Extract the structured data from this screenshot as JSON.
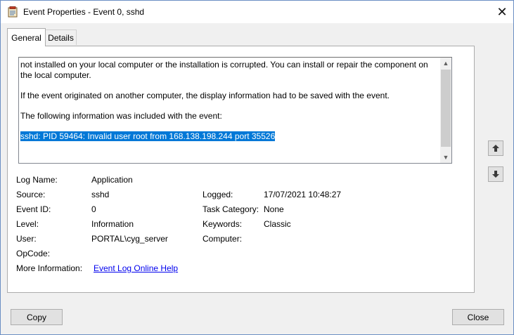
{
  "window": {
    "title": "Event Properties - Event 0, sshd",
    "close_glyph": "✕"
  },
  "tabs": [
    {
      "label": "General",
      "selected": true
    },
    {
      "label": "Details",
      "selected": false
    }
  ],
  "message": {
    "paragraphs": [
      "not installed on your local computer or the installation is corrupted. You can install or repair the component on the local computer.",
      "If the event originated on another computer, the display information had to be saved with the event.",
      "The following information was included with the event:"
    ],
    "selected_line": "sshd: PID 59464: Invalid user root from 168.138.198.244 port 35526",
    "scroll_up_glyph": "▲",
    "scroll_down_glyph": "▼"
  },
  "fields": {
    "log_name_label": "Log Name:",
    "log_name_value": "Application",
    "source_label": "Source:",
    "source_value": "sshd",
    "logged_label": "Logged:",
    "logged_value": "17/07/2021 10:48:27",
    "event_id_label": "Event ID:",
    "event_id_value": "0",
    "task_category_label": "Task Category:",
    "task_category_value": "None",
    "level_label": "Level:",
    "level_value": "Information",
    "keywords_label": "Keywords:",
    "keywords_value": "Classic",
    "user_label": "User:",
    "user_value": "PORTAL\\cyg_server",
    "computer_label": "Computer:",
    "computer_value": "",
    "opcode_label": "OpCode:",
    "opcode_value": "",
    "more_info_label": "More Information:",
    "more_info_link": "Event Log Online Help"
  },
  "buttons": {
    "copy": "Copy",
    "close": "Close"
  },
  "colors": {
    "selection": "#0078d7",
    "link": "#0000ee",
    "window_border": "#6b8fc4"
  }
}
